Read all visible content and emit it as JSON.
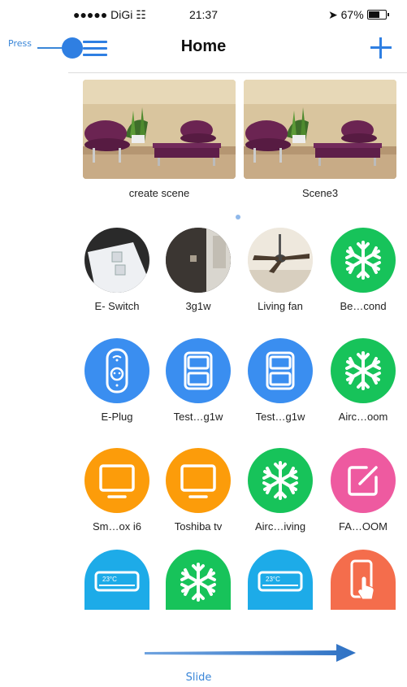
{
  "status_bar": {
    "carrier": "●●●●● DiGi",
    "time": "21:37",
    "battery": "67%"
  },
  "nav": {
    "title": "Home",
    "menu_icon": "hamburger-menu-icon",
    "add_icon": "plus-icon"
  },
  "annotations": {
    "press": "Press",
    "slide": "Slide"
  },
  "scenes": [
    {
      "label": "create scene",
      "image": "living-room-photo"
    },
    {
      "label": "Scene3",
      "image": "living-room-photo"
    }
  ],
  "devices": [
    {
      "label": "E- Switch",
      "icon": "wall-switch-photo"
    },
    {
      "label": "3g1w",
      "icon": "wall-switch-photo"
    },
    {
      "label": "Living fan",
      "icon": "ceiling-fan-photo"
    },
    {
      "label": "Be…cond",
      "icon": "snowflake-icon",
      "color": "#17c35a"
    },
    {
      "label": "E-Plug",
      "icon": "plug-icon",
      "color": "#3a8ef0"
    },
    {
      "label": "Test…g1w",
      "icon": "switch-panel-icon",
      "color": "#3a8ef0"
    },
    {
      "label": "Test…g1w",
      "icon": "switch-panel-icon",
      "color": "#3a8ef0"
    },
    {
      "label": "Airc…oom",
      "icon": "snowflake-icon",
      "color": "#17c35a"
    },
    {
      "label": "Sm…ox i6",
      "icon": "tv-icon",
      "color": "#fc9c0a"
    },
    {
      "label": "Toshiba tv",
      "icon": "tv-icon",
      "color": "#fc9c0a"
    },
    {
      "label": "Airc…iving",
      "icon": "snowflake-icon",
      "color": "#17c35a"
    },
    {
      "label": "FA…OOM",
      "icon": "edit-icon",
      "color": "#ee5aa0"
    },
    {
      "label": "",
      "icon": "air-conditioner-icon",
      "color": "#1dabe8"
    },
    {
      "label": "",
      "icon": "snowflake-icon",
      "color": "#17c35a"
    },
    {
      "label": "",
      "icon": "air-conditioner-icon",
      "color": "#1dabe8"
    },
    {
      "label": "",
      "icon": "phone-touch-icon",
      "color": "#f46d4c"
    }
  ],
  "ac_display": "23°C"
}
